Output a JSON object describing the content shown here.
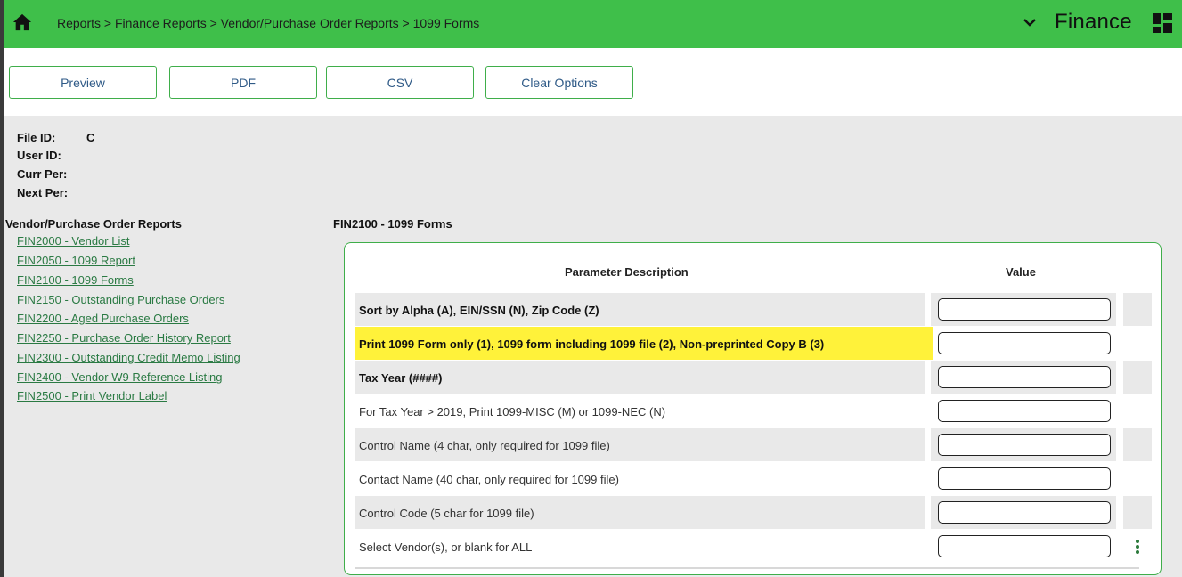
{
  "header": {
    "home_icon": "home-icon",
    "breadcrumb": "Reports > Finance Reports > Vendor/Purchase Order Reports > 1099 Forms",
    "app_title": "Finance",
    "chevron_icon": "chevron-down-icon",
    "apps_icon": "grid-icon",
    "bar_color": "#3fbf4a"
  },
  "toolbar": {
    "preview_label": "Preview",
    "pdf_label": "PDF",
    "csv_label": "CSV",
    "clear_label": "Clear Options"
  },
  "info": {
    "file_id_label": "File ID:",
    "file_id_value": "C",
    "user_id_label": "User ID:",
    "curr_per_label": "Curr Per:",
    "next_per_label": "Next Per:"
  },
  "sidebar": {
    "title": "Vendor/Purchase Order Reports",
    "items": [
      "FIN2000 - Vendor List",
      "FIN2050 - 1099 Report",
      "FIN2100 - 1099 Forms",
      "FIN2150 - Outstanding Purchase Orders",
      "FIN2200 - Aged Purchase Orders",
      "FIN2250 - Purchase Order History Report",
      "FIN2300 - Outstanding Credit Memo Listing",
      "FIN2400 - Vendor W9 Reference Listing",
      "FIN2500 - Print Vendor Label"
    ]
  },
  "report": {
    "title": "FIN2100 - 1099 Forms",
    "col_param": "Parameter Description",
    "col_value": "Value",
    "highlight_color": "#fff23a",
    "rows": [
      {
        "desc": "Sort by Alpha (A), EIN/SSN (N), Zip Code (Z)",
        "value": ""
      },
      {
        "desc": "Print 1099 Form only (1), 1099 form including 1099 file (2), Non-preprinted Copy B (3)",
        "value": ""
      },
      {
        "desc": "Tax Year (####)",
        "value": ""
      },
      {
        "desc": "For Tax Year > 2019, Print 1099-MISC (M) or 1099-NEC (N)",
        "value": ""
      },
      {
        "desc": "Control Name (4 char, only required for 1099 file)",
        "value": ""
      },
      {
        "desc": "Contact Name (40 char, only required for 1099 file)",
        "value": ""
      },
      {
        "desc": "Control Code (5 char for 1099 file)",
        "value": ""
      },
      {
        "desc": "Select Vendor(s), or blank for ALL",
        "value": ""
      }
    ],
    "lookup_icon": "kebab-icon"
  }
}
